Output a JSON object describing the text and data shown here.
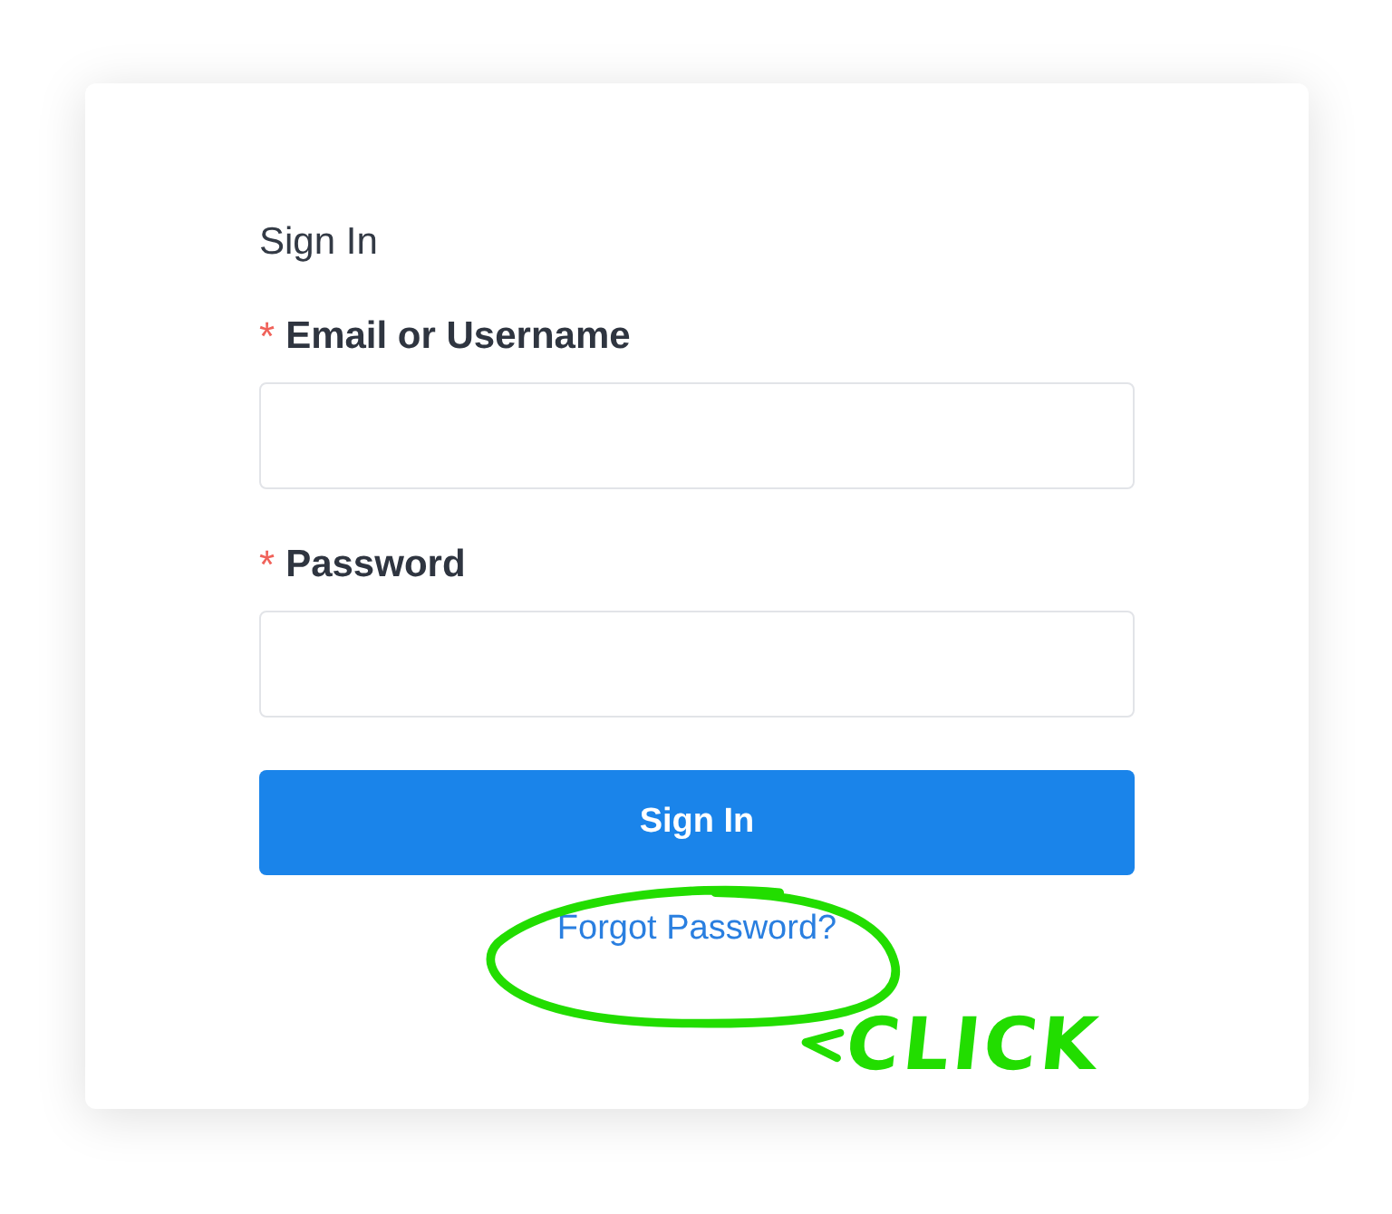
{
  "form": {
    "title": "Sign In",
    "fields": [
      {
        "label": "Email or Username",
        "required_mark": "*"
      },
      {
        "label": "Password",
        "required_mark": "*"
      }
    ],
    "submit": "Sign In",
    "link": "Forgot Password?"
  },
  "annotation": {
    "text": "CLICK"
  }
}
